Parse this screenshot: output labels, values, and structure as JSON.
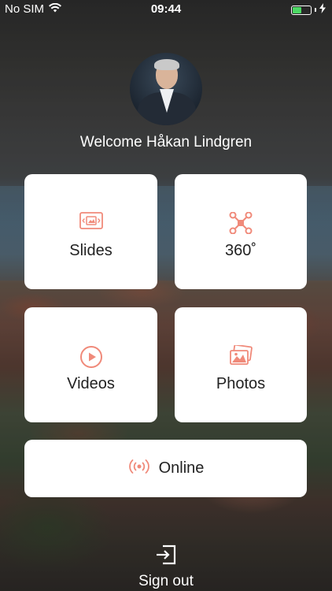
{
  "status_bar": {
    "carrier": "No SIM",
    "time": "09:44",
    "battery_percent": 55,
    "charging": true
  },
  "colors": {
    "accent": "#f08a7a",
    "tile_bg": "#ffffff",
    "text_light": "#ffffff",
    "battery_green": "#4cd964"
  },
  "profile": {
    "welcome_text": "Welcome Håkan Lindgren"
  },
  "tiles": [
    {
      "label": "Slides",
      "icon": "slides-icon"
    },
    {
      "label": "360˚",
      "icon": "drone-icon"
    },
    {
      "label": "Videos",
      "icon": "play-icon"
    },
    {
      "label": "Photos",
      "icon": "photos-icon"
    }
  ],
  "online": {
    "label": "Online",
    "icon": "broadcast-icon"
  },
  "signout": {
    "label": "Sign out",
    "icon": "sign-out-icon"
  }
}
